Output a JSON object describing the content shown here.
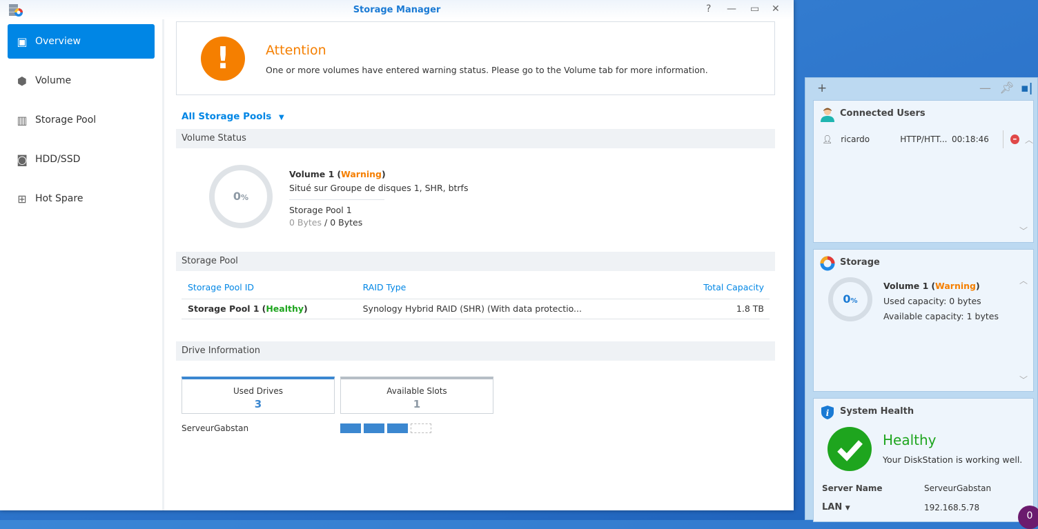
{
  "window": {
    "title": "Storage Manager",
    "help": "?",
    "minimize": "—",
    "maximize": "▭",
    "close": "✕"
  },
  "sidebar": {
    "items": [
      {
        "label": "Overview",
        "icon": "overview-icon"
      },
      {
        "label": "Volume",
        "icon": "cubes-icon"
      },
      {
        "label": "Storage Pool",
        "icon": "storage-pool-icon"
      },
      {
        "label": "HDD/SSD",
        "icon": "disk-icon"
      },
      {
        "label": "Hot Spare",
        "icon": "plus-box-icon"
      }
    ]
  },
  "alert": {
    "title": "Attention",
    "message": "One or more volumes have entered warning status. Please go to the Volume tab for more information."
  },
  "pool_selector": "All Storage Pools",
  "volume_status": {
    "heading": "Volume Status",
    "percent": "0",
    "unit": "%",
    "name": "Volume 1",
    "status": "Warning",
    "location": "Situé sur Groupe de disques 1, SHR, btrfs",
    "pool": "Storage Pool 1",
    "used": "0 Bytes",
    "sep": "/",
    "total": "0 Bytes"
  },
  "storage_pool": {
    "heading": "Storage Pool",
    "columns": [
      "Storage Pool ID",
      "RAID Type",
      "Total Capacity"
    ],
    "rows": [
      {
        "name": "Storage Pool 1",
        "status": "Healthy",
        "raid": "Synology Hybrid RAID (SHR) (With data protectio...",
        "capacity": "1.8 TB"
      }
    ]
  },
  "drive_info": {
    "heading": "Drive Information",
    "used_label": "Used Drives",
    "used": "3",
    "avail_label": "Available Slots",
    "avail": "1",
    "server": "ServeurGabstan"
  },
  "widgets": {
    "connected_users": {
      "title": "Connected Users",
      "user": "ricardo",
      "protocol": "HTTP/HTT...",
      "time": "00:18:46"
    },
    "storage": {
      "title": "Storage",
      "percent": "0",
      "unit": "%",
      "volume": "Volume 1",
      "status": "Warning",
      "used": "Used capacity: 0 bytes",
      "available": "Available capacity: 1 bytes"
    },
    "health": {
      "title": "System Health",
      "status": "Healthy",
      "message": "Your DiskStation is working well.",
      "server_label": "Server Name",
      "server": "ServeurGabstan",
      "lan_label": "LAN",
      "ip": "192.168.5.78"
    }
  },
  "notification_count": "0",
  "colors": {
    "accent": "#0086e5",
    "warning": "#f57f00",
    "healthy": "#1ea51e"
  }
}
